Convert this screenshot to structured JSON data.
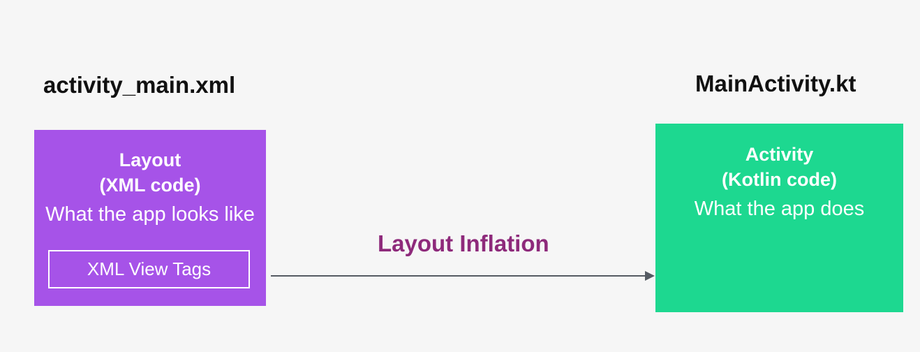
{
  "left": {
    "file_name": "activity_main.xml",
    "box_title_line1": "Layout",
    "box_title_line2": "(XML code)",
    "box_description": "What the app looks like",
    "inner_tag_label": "XML View Tags",
    "color": "#a653e8"
  },
  "right": {
    "file_name": "MainActivity.kt",
    "box_title_line1": "Activity",
    "box_title_line2": "(Kotlin code)",
    "box_description": "What the app does",
    "color": "#1dd890"
  },
  "arrow": {
    "label": "Layout Inflation",
    "label_color": "#8e2a7b",
    "line_color": "#555b63"
  }
}
